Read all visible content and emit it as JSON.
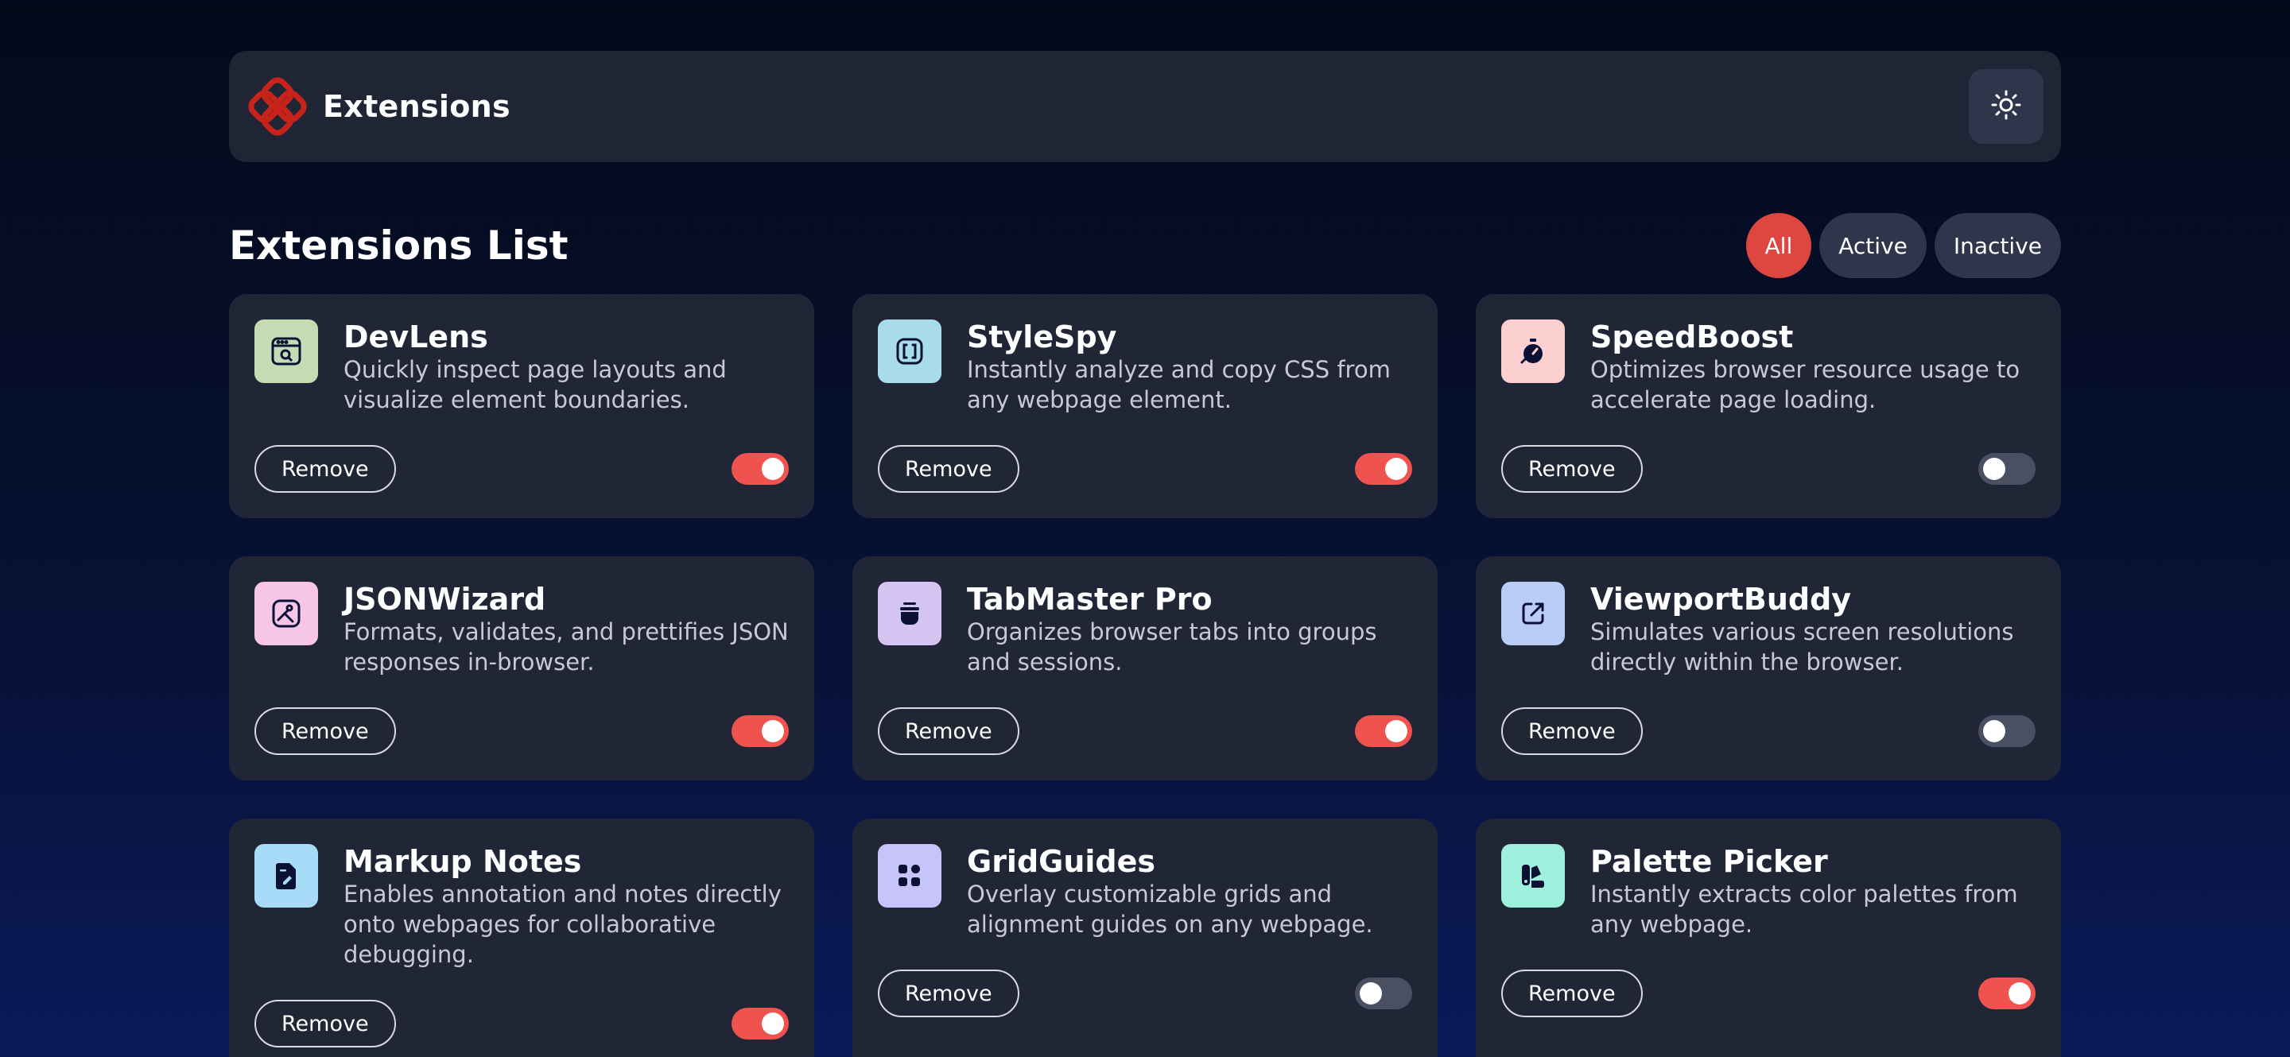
{
  "header": {
    "title": "Extensions",
    "logo_icon": "extensions-logo-icon",
    "theme_toggle_icon": "sun-icon"
  },
  "list": {
    "title": "Extensions List",
    "filters": [
      {
        "label": "All",
        "active": true
      },
      {
        "label": "Active",
        "active": false
      },
      {
        "label": "Inactive",
        "active": false
      }
    ]
  },
  "remove_label": "Remove",
  "extensions": [
    {
      "name": "DevLens",
      "description": "Quickly inspect page layouts and visualize element boundaries.",
      "enabled": true,
      "icon": "devlens-icon",
      "icon_bg": "#c4dbb4"
    },
    {
      "name": "StyleSpy",
      "description": "Instantly analyze and copy CSS from any webpage element.",
      "enabled": true,
      "icon": "stylespy-icon",
      "icon_bg": "#a9dcea"
    },
    {
      "name": "SpeedBoost",
      "description": "Optimizes browser resource usage to accelerate page loading.",
      "enabled": false,
      "icon": "speedboost-icon",
      "icon_bg": "#fcd0d0"
    },
    {
      "name": "JSONWizard",
      "description": "Formats, validates, and prettifies JSON responses in-browser.",
      "enabled": true,
      "icon": "jsonwizard-icon",
      "icon_bg": "#f7c5e6"
    },
    {
      "name": "TabMaster Pro",
      "description": "Organizes browser tabs into groups and sessions.",
      "enabled": true,
      "icon": "tabmaster-icon",
      "icon_bg": "#d6c4f2"
    },
    {
      "name": "ViewportBuddy",
      "description": "Simulates various screen resolutions directly within the browser.",
      "enabled": false,
      "icon": "viewportbuddy-icon",
      "icon_bg": "#b9cdf7"
    },
    {
      "name": "Markup Notes",
      "description": "Enables annotation and notes directly onto webpages for collaborative debugging.",
      "enabled": true,
      "icon": "markup-notes-icon",
      "icon_bg": "#a7dbf7"
    },
    {
      "name": "GridGuides",
      "description": "Overlay customizable grids and alignment guides on any webpage.",
      "enabled": false,
      "icon": "gridguides-icon",
      "icon_bg": "#c6c4fb"
    },
    {
      "name": "Palette Picker",
      "description": "Instantly extracts color palettes from any webpage.",
      "enabled": true,
      "icon": "palette-picker-icon",
      "icon_bg": "#9ef0dc"
    }
  ],
  "colors": {
    "accent": "#de473f",
    "toggle_on": "#ef5350",
    "toggle_off": "#4a5062",
    "card_bg": "#212636",
    "icon_ink": "#0b1135"
  }
}
